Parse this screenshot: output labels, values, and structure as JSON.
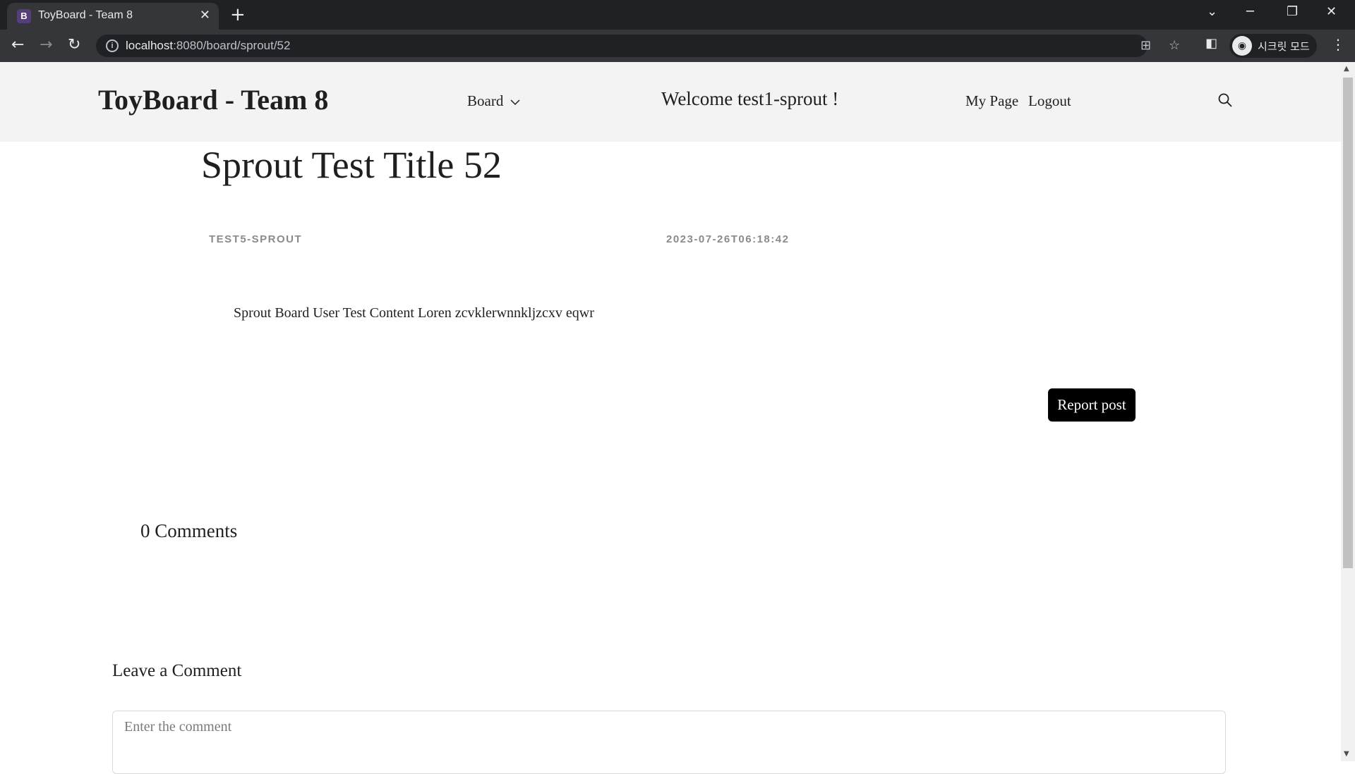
{
  "browser": {
    "tab_favicon_letter": "B",
    "tab_title": "ToyBoard - Team 8",
    "tab_close": "✕",
    "new_tab": "+",
    "url_host": "localhost",
    "url_path": ":8080/board/sprout/52",
    "profile_label": "시크릿 모드",
    "icons": [
      "back-icon",
      "forward-icon",
      "reload-icon",
      "info-icon",
      "translate-icon",
      "star-icon",
      "side-panel-icon",
      "incognito-icon",
      "menu-icon"
    ]
  },
  "header": {
    "logo": "ToyBoard - Team 8",
    "board_menu": "Board",
    "welcome": "Welcome test1-sprout !",
    "my_page": "My Page",
    "logout": "Logout"
  },
  "post": {
    "title": "Sprout Test Title 52",
    "author": "TEST5-SPROUT",
    "date": "2023-07-26T06:18:42",
    "content": "Sprout Board User Test Content Loren zcvklerwnnkljzcxv eqwr",
    "report_label": "Report post"
  },
  "comments": {
    "count_label": "0 Comments",
    "leave_heading": "Leave a Comment",
    "input_placeholder": "Enter the comment"
  }
}
